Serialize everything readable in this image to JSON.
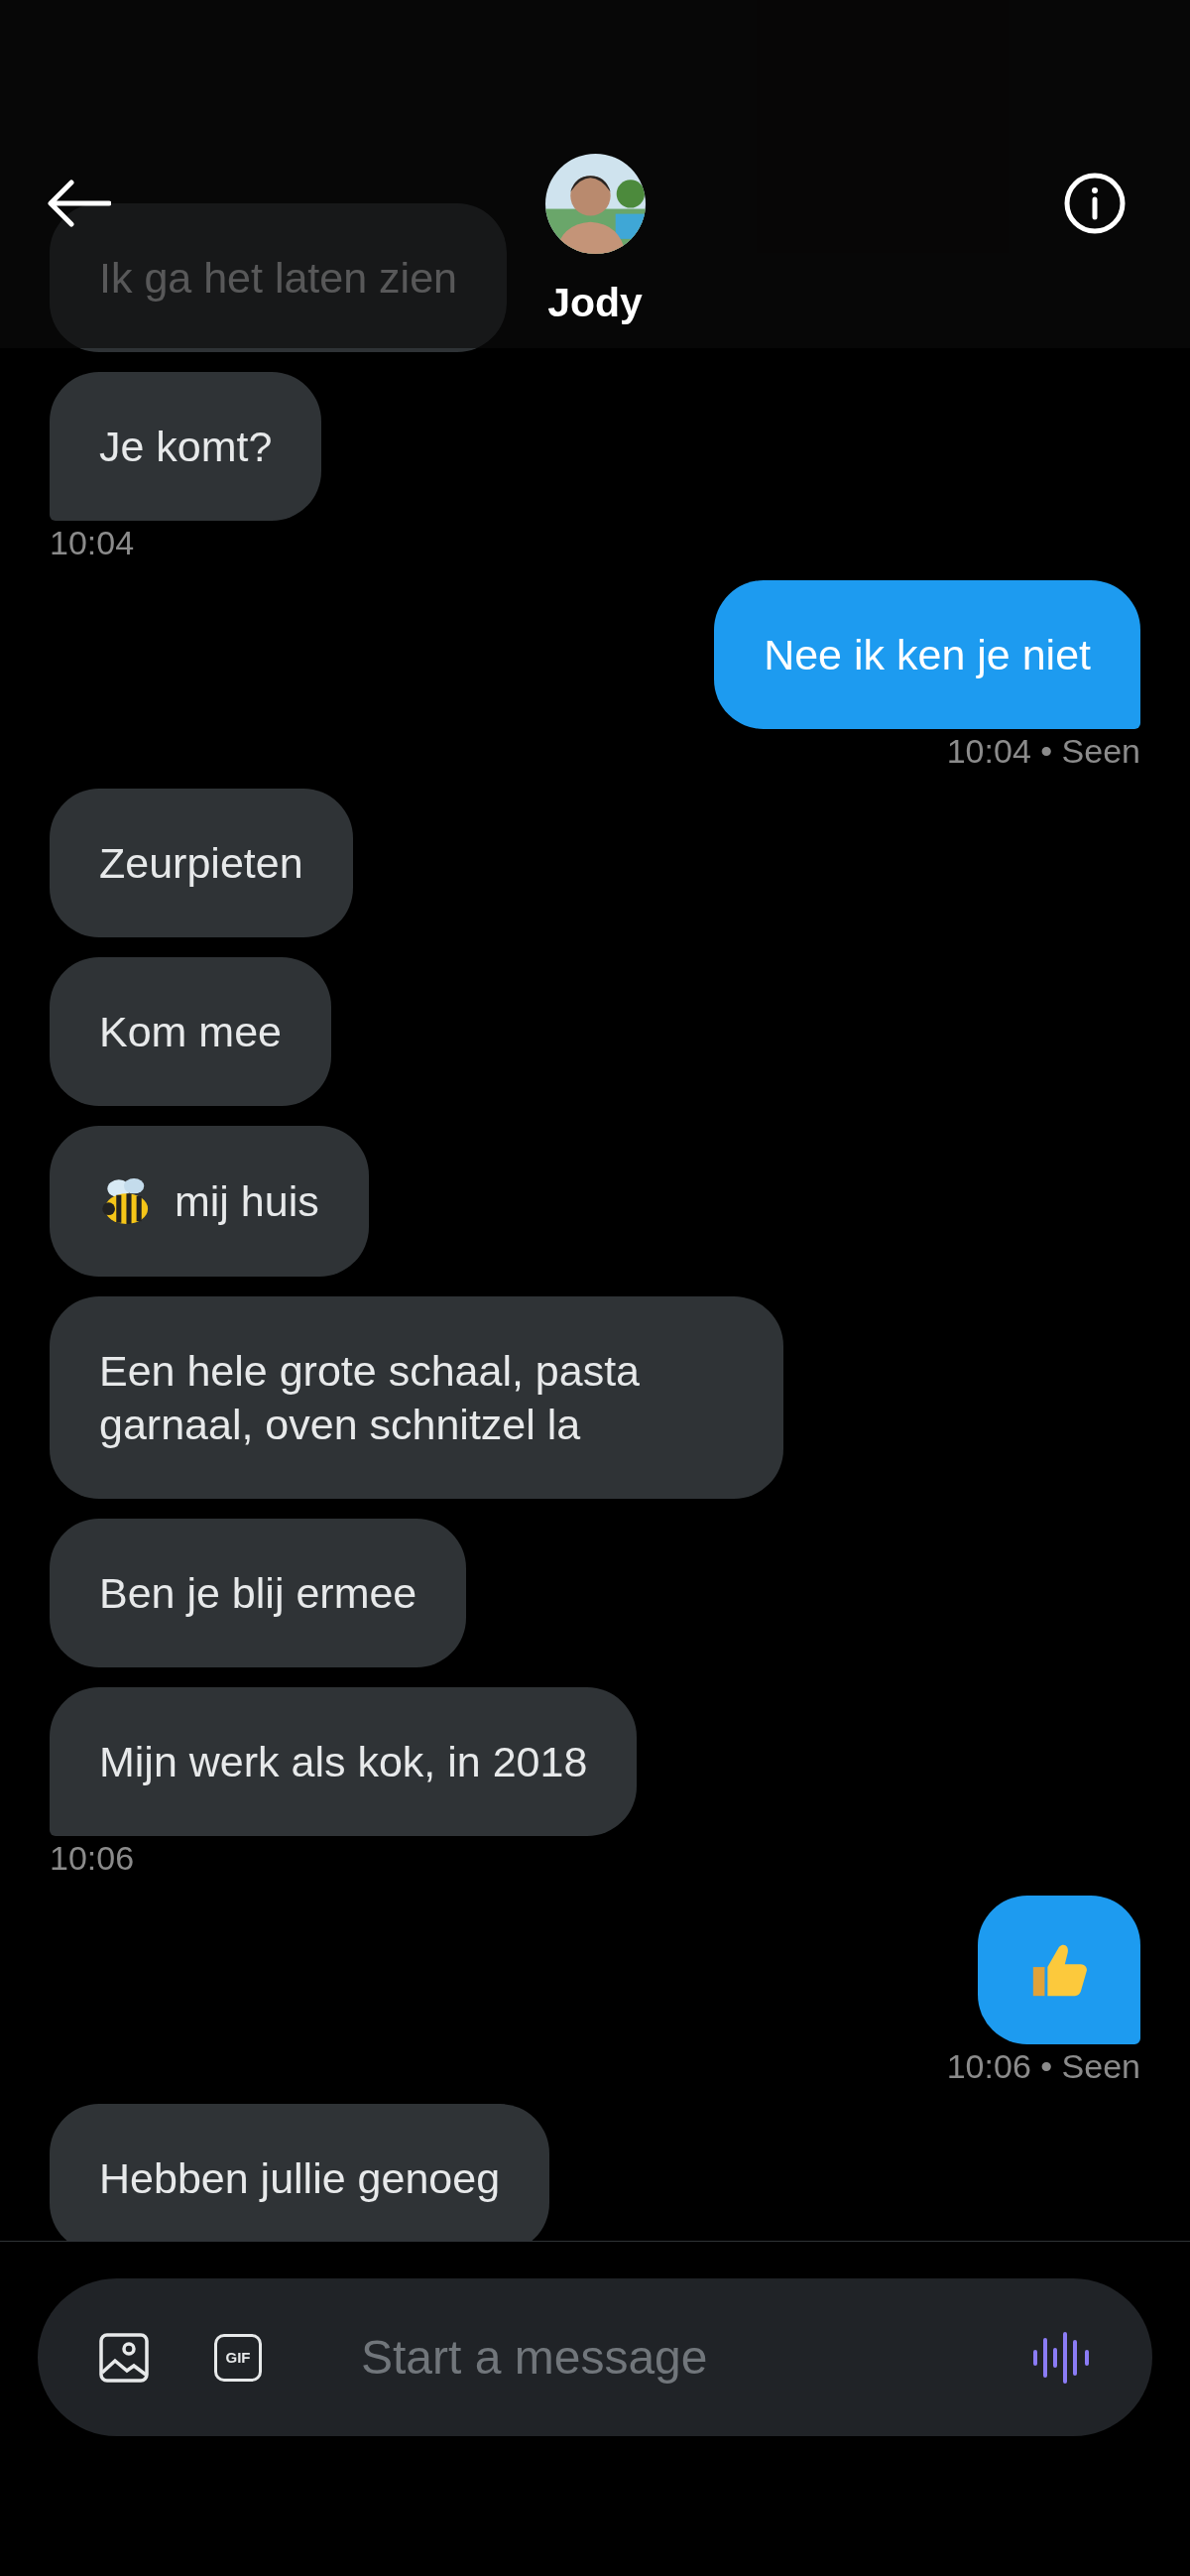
{
  "header": {
    "title": "Jody"
  },
  "messages": [
    {
      "kind": "received",
      "text": "Ik ga het laten zien",
      "tail": false
    },
    {
      "kind": "received",
      "text": "Je komt?",
      "tail": true,
      "time": "10:04"
    },
    {
      "kind": "sent",
      "text": "Nee ik ken je niet",
      "tail": true,
      "time": "10:04 • Seen"
    },
    {
      "kind": "received",
      "text": "Zeurpieten",
      "tail": false
    },
    {
      "kind": "received",
      "text": "Kom mee",
      "tail": false
    },
    {
      "kind": "received",
      "text": "mij huis",
      "tail": false
    },
    {
      "kind": "received",
      "text": "Een hele grote schaal, pasta garnaal, oven schnitzel la",
      "tail": false
    },
    {
      "kind": "received",
      "text": "Ben je blij ermee",
      "tail": false
    },
    {
      "kind": "received",
      "text": "Mijn werk als kok, in 2018",
      "tail": true,
      "time": "10:06"
    },
    {
      "kind": "sent",
      "tail": true,
      "time": "10:06 • Seen"
    },
    {
      "kind": "received",
      "text": "Hebben jullie genoeg"
    }
  ],
  "composer": {
    "gif_label": "GIF",
    "placeholder": "Start a message"
  }
}
